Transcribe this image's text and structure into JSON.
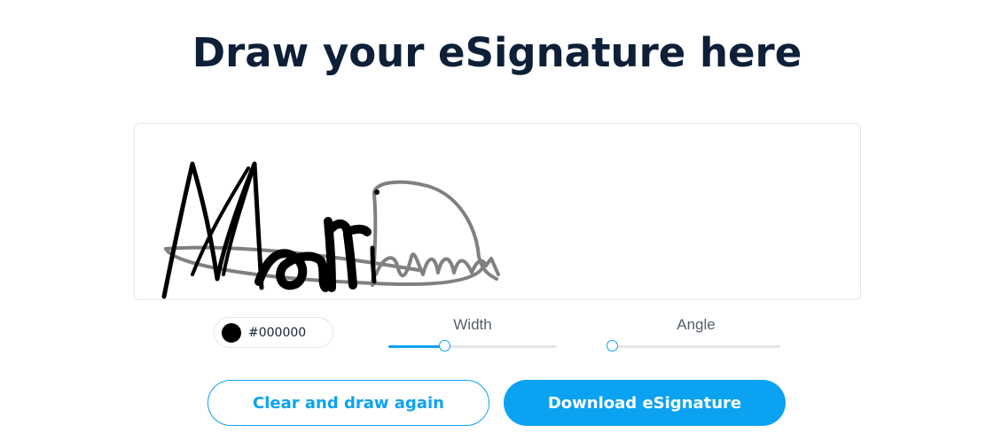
{
  "header": {
    "title": "Draw your eSignature here"
  },
  "pen": {
    "color_value": "#000000",
    "swatch_color": "#000000"
  },
  "width_slider": {
    "label": "Width",
    "value_fraction": 0.33
  },
  "angle_slider": {
    "label": "Angle",
    "value_fraction": 0.0
  },
  "actions": {
    "clear_label": "Clear and draw again",
    "download_label": "Download eSignature"
  },
  "theme": {
    "accent": "#0ba2f2",
    "title_color": "#0e1f38",
    "ink_primary": "#000000",
    "ink_secondary": "#808080"
  }
}
